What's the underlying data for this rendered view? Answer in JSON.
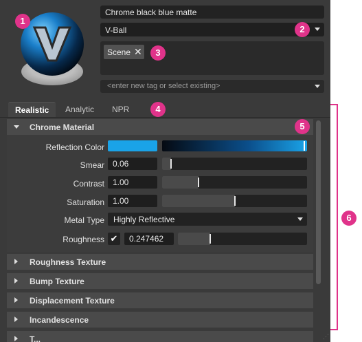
{
  "material": {
    "name": "Chrome black blue matte",
    "type": "V-Ball",
    "tags": [
      {
        "label": "Scene"
      }
    ],
    "tag_input_placeholder": "<enter new tag or select existing>"
  },
  "tabs": [
    {
      "label": "Realistic",
      "active": true
    },
    {
      "label": "Analytic",
      "active": false
    },
    {
      "label": "NPR",
      "active": false
    }
  ],
  "chrome_section": {
    "title": "Chrome Material",
    "reflection_color": {
      "label": "Reflection Color",
      "color": "#1aa3e8"
    },
    "smear": {
      "label": "Smear",
      "value": "0.06",
      "fraction": 0.06
    },
    "contrast": {
      "label": "Contrast",
      "value": "1.00",
      "fraction": 0.25
    },
    "saturation": {
      "label": "Saturation",
      "value": "1.00",
      "fraction": 0.5
    },
    "metal_type": {
      "label": "Metal Type",
      "value": "Highly Reflective"
    },
    "roughness": {
      "label": "Roughness",
      "checked": true,
      "value": "0.247462",
      "fraction": 0.25
    }
  },
  "collapsed_sections": [
    {
      "title": "Roughness Texture"
    },
    {
      "title": "Bump Texture"
    },
    {
      "title": "Displacement Texture"
    },
    {
      "title": "Incandescence"
    },
    {
      "title": "T..."
    }
  ],
  "callouts": [
    "1",
    "2",
    "3",
    "4",
    "5",
    "6"
  ],
  "colors": {
    "accent": "#e0338a",
    "panel": "#3a3a3a",
    "highlight": "#1aa3e8"
  }
}
